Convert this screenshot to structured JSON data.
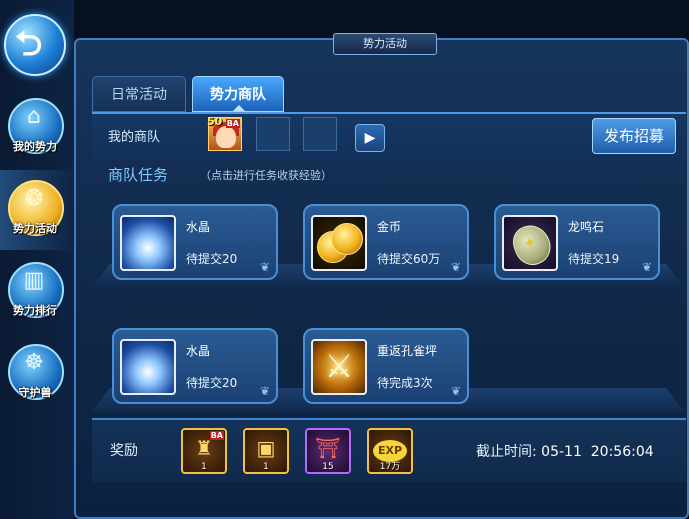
{
  "panel_title": "势力活动",
  "sidebar": {
    "items": [
      {
        "label": "我的势力",
        "icon": "guild-hall-icon"
      },
      {
        "label": "势力活动",
        "icon": "gourd-icon"
      },
      {
        "label": "势力排行",
        "icon": "ranking-icon"
      },
      {
        "label": "守护兽",
        "icon": "beast-icon"
      }
    ]
  },
  "tabs": [
    {
      "label": "日常活动"
    },
    {
      "label": "势力商队"
    }
  ],
  "caravan": {
    "label": "我的商队",
    "hero": {
      "level": "50",
      "tag": "BA"
    },
    "publish_label": "发布招募"
  },
  "tasks_section": {
    "title": "商队任务",
    "hint": "（点击进行任务收获经验）",
    "tasks": [
      {
        "name": "水晶",
        "status": "待提交20",
        "icon": "crystal-icon"
      },
      {
        "name": "金币",
        "status": "待提交60万",
        "icon": "gold-coin-icon"
      },
      {
        "name": "龙鸣石",
        "status": "待提交19",
        "icon": "dragon-stone-icon"
      },
      {
        "name": "水晶",
        "status": "待提交20",
        "icon": "crystal-icon"
      },
      {
        "name": "重返孔雀坪",
        "status": "待完成3次",
        "icon": "crossed-swords-icon"
      }
    ]
  },
  "rewards": {
    "label": "奖励",
    "items": [
      {
        "count": "1",
        "icon": "hero-bag-icon",
        "tag": "BA"
      },
      {
        "count": "1",
        "icon": "treasure-chest-icon"
      },
      {
        "count": "15",
        "icon": "scroll-banner-icon"
      },
      {
        "count": "17万",
        "icon": "exp-icon",
        "text": "EXP"
      }
    ]
  },
  "deadline": {
    "label": "截止时间:",
    "value": "05-11  20:56:04"
  }
}
